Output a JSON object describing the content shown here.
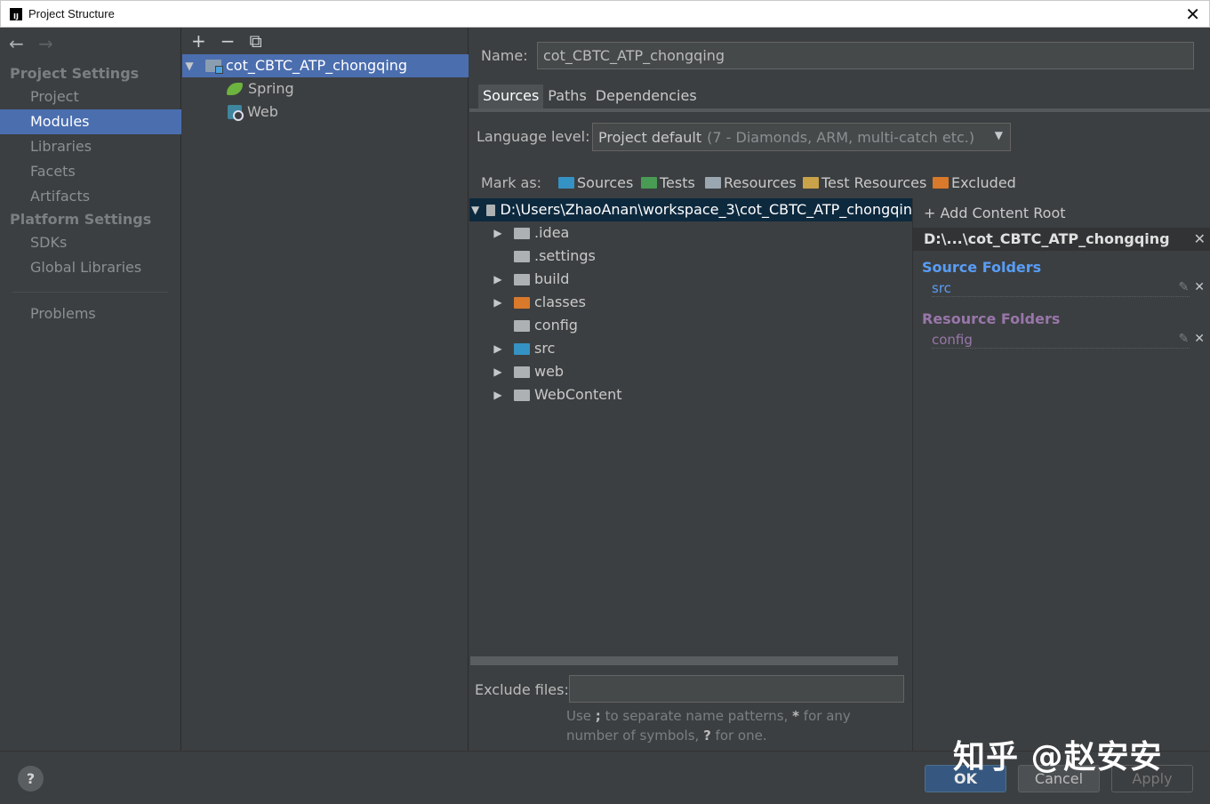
{
  "window": {
    "title": "Project Structure",
    "app_icon": "intellij-icon",
    "close_glyph": "✕"
  },
  "nav": {
    "back_glyph": "←",
    "forward_glyph": "→",
    "project_settings_header": "Project Settings",
    "platform_settings_header": "Platform Settings",
    "items": {
      "project": "Project",
      "modules": "Modules",
      "libraries": "Libraries",
      "facets": "Facets",
      "artifacts": "Artifacts",
      "sdks": "SDKs",
      "global_libraries": "Global Libraries",
      "problems": "Problems"
    },
    "selected": "Modules",
    "active_color": "#4b6eaf"
  },
  "module_toolbar": {
    "add_glyph": "+",
    "remove_glyph": "−",
    "copy_glyph": "⧉"
  },
  "module_tree": {
    "root": "cot_CBTC_ATP_chongqing",
    "children": [
      "Spring",
      "Web"
    ]
  },
  "details": {
    "name_label": "Name:",
    "name_value": "cot_CBTC_ATP_chongqing",
    "tabs": [
      "Sources",
      "Paths",
      "Dependencies"
    ],
    "active_tab": "Sources",
    "language_level_label": "Language level:",
    "language_level_value": "Project default",
    "language_level_detail": "(7 - Diamonds, ARM, multi-catch etc.)",
    "mark_as_label": "Mark as:",
    "mark_as": [
      {
        "label": "Sources",
        "color": "#3592c4"
      },
      {
        "label": "Tests",
        "color": "#499c54"
      },
      {
        "label": "Resources",
        "color": "#9aa7b0"
      },
      {
        "label": "Test Resources",
        "color": "#c9a24a"
      },
      {
        "label": "Excluded",
        "color": "#d9792b"
      }
    ]
  },
  "directory_tree": {
    "root": "D:\\Users\\ZhaoAnan\\workspace_3\\cot_CBTC_ATP_chongqin",
    "children": [
      {
        "name": ".idea",
        "expandable": true,
        "color": "#aeb1b3"
      },
      {
        "name": ".settings",
        "expandable": false,
        "color": "#aeb1b3"
      },
      {
        "name": "build",
        "expandable": true,
        "color": "#aeb1b3"
      },
      {
        "name": "classes",
        "expandable": true,
        "color": "#d9792b"
      },
      {
        "name": "config",
        "expandable": false,
        "color": "#aeb1b3"
      },
      {
        "name": "src",
        "expandable": true,
        "color": "#3592c4"
      },
      {
        "name": "web",
        "expandable": true,
        "color": "#aeb1b3"
      },
      {
        "name": "WebContent",
        "expandable": true,
        "color": "#aeb1b3"
      }
    ]
  },
  "exclude": {
    "label": "Exclude files:",
    "value": "",
    "hint_part1": "Use ",
    "hint_semicolon": ";",
    "hint_part2": " to separate name patterns, ",
    "hint_star": "*",
    "hint_part3": " for any number of symbols, ",
    "hint_question": "?",
    "hint_part4": " for one."
  },
  "content_roots": {
    "add_label": "+ Add Content Root",
    "root_label": "D:\\...\\cot_CBTC_ATP_chongqing",
    "source_folders_title": "Source Folders",
    "source_folders": [
      "src"
    ],
    "source_color": "#589df6",
    "resource_folders_title": "Resource Folders",
    "resource_folders": [
      "config"
    ],
    "resource_color": "#9876aa"
  },
  "buttons": {
    "help": "?",
    "ok": "OK",
    "cancel": "Cancel",
    "apply": "Apply"
  },
  "watermark": "知乎 @赵安安"
}
